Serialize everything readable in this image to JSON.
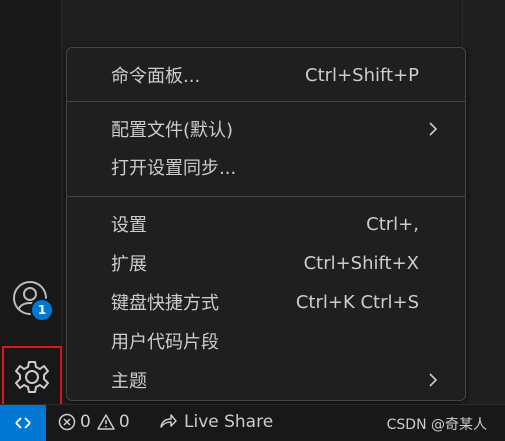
{
  "menu": {
    "items": [
      {
        "label": "命令面板...",
        "shortcut": "Ctrl+Shift+P"
      },
      {
        "label": "配置文件(默认)",
        "shortcut": "",
        "submenu": true
      },
      {
        "label": "打开设置同步...",
        "shortcut": ""
      },
      {
        "label": "设置",
        "shortcut": "Ctrl+,"
      },
      {
        "label": "扩展",
        "shortcut": "Ctrl+Shift+X"
      },
      {
        "label": "键盘快捷方式",
        "shortcut": "Ctrl+K Ctrl+S"
      },
      {
        "label": "用户代码片段",
        "shortcut": ""
      },
      {
        "label": "主题",
        "shortcut": "",
        "submenu": true
      }
    ]
  },
  "activity": {
    "account_badge": "1"
  },
  "status": {
    "errors": "0",
    "warnings": "0",
    "live_share": "Live Share",
    "watermark": "CSDN @奇某人"
  },
  "colors": {
    "accent": "#0078d4",
    "highlight_box": "#e81123",
    "background": "#181818"
  },
  "icons": [
    "account-icon",
    "gear-icon",
    "remote-icon",
    "error-icon",
    "warning-icon",
    "live-share-icon",
    "chevron-right-icon"
  ]
}
